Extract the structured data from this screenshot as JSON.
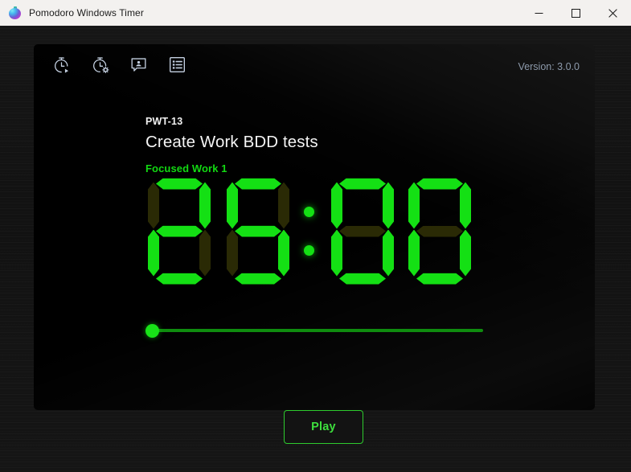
{
  "window": {
    "title": "Pomodoro Windows Timer",
    "app_icon": "pomodoro-tomato-icon",
    "controls": [
      {
        "name": "minimize-button",
        "icon": "minimize-icon",
        "label": "Minimize"
      },
      {
        "name": "maximize-button",
        "icon": "maximize-icon",
        "label": "Maximize"
      },
      {
        "name": "close-button",
        "icon": "close-icon",
        "label": "Close"
      }
    ]
  },
  "toolbar": {
    "items": [
      {
        "name": "timer-start-button",
        "icon": "stopwatch-play-icon",
        "tooltip": "Timer"
      },
      {
        "name": "timer-settings-button",
        "icon": "stopwatch-gear-icon",
        "tooltip": "Settings"
      },
      {
        "name": "feedback-button",
        "icon": "person-message-icon",
        "tooltip": "Feedback"
      },
      {
        "name": "log-button",
        "icon": "list-square-icon",
        "tooltip": "Log"
      }
    ]
  },
  "version": {
    "label": "Version: 3.0.0"
  },
  "task": {
    "id": "PWT-13",
    "title": "Create Work BDD tests",
    "phase": "Focused Work 1"
  },
  "timer": {
    "value": "25:00",
    "minutes": "25",
    "seconds": "00",
    "digits": [
      "2",
      "5",
      "0",
      "0"
    ],
    "separator": ":"
  },
  "progress": {
    "value": 0,
    "min": 0,
    "max": 100
  },
  "actions": {
    "play_label": "Play"
  },
  "colors": {
    "lcd_on": "#14e014",
    "lcd_off": "#2a2a05",
    "accent_green": "#2ecc2e",
    "phase_green": "#12d912",
    "panel_bg": "#000000",
    "window_bg": "#141414",
    "titlebar_bg": "#f3f1ef",
    "version_text": "#8d9aab"
  }
}
